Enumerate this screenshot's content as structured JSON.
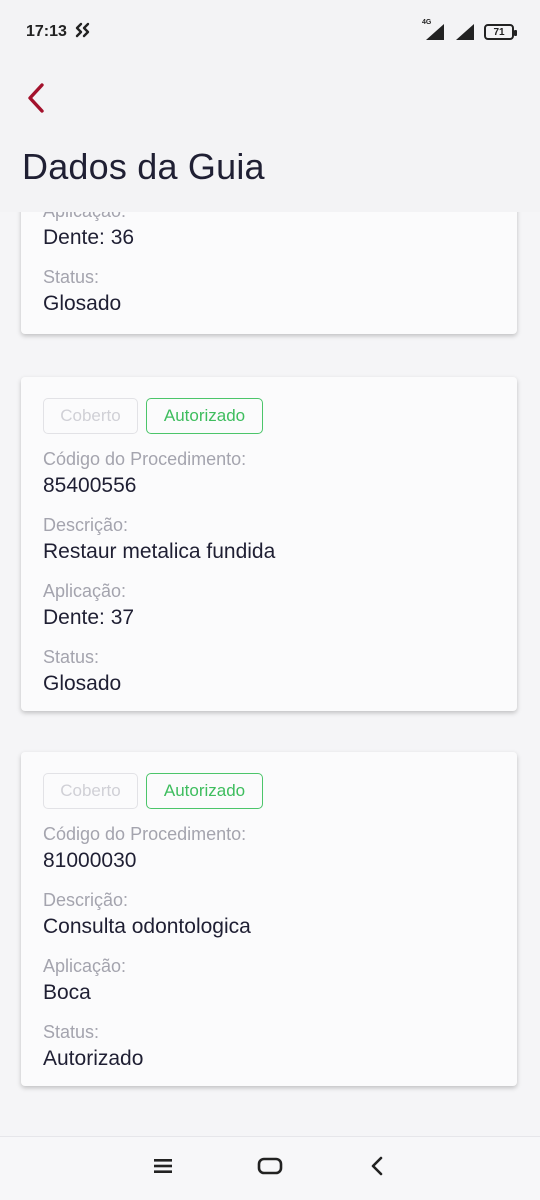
{
  "status_bar": {
    "time": "17:13",
    "network": "4G",
    "battery": "71",
    "icons": [
      "speed-icon",
      "signal-icon",
      "signal-icon",
      "battery-icon"
    ]
  },
  "header": {
    "title": "Dados da Guia",
    "back_icon": "chevron-left-icon",
    "accent_color": "#a3112c"
  },
  "cards": [
    {
      "fields": [
        {
          "label": "Aplicação:",
          "value": "Dente: 36"
        },
        {
          "label": "Status:",
          "value": "Glosado"
        }
      ]
    },
    {
      "badges": [
        "Coberto",
        "Autorizado"
      ],
      "fields": [
        {
          "label": "Código do Procedimento:",
          "value": "85400556"
        },
        {
          "label": "Descrição:",
          "value": "Restaur metalica fundida"
        },
        {
          "label": "Aplicação:",
          "value": "Dente: 37"
        },
        {
          "label": "Status:",
          "value": "Glosado"
        }
      ]
    },
    {
      "badges": [
        "Coberto",
        "Autorizado"
      ],
      "fields": [
        {
          "label": "Código do Procedimento:",
          "value": "81000030"
        },
        {
          "label": "Descrição:",
          "value": "Consulta odontologica"
        },
        {
          "label": "Aplicação:",
          "value": "Boca"
        },
        {
          "label": "Status:",
          "value": "Autorizado"
        }
      ]
    }
  ],
  "colors": {
    "authorized": "#3ebd5e",
    "muted_badge": "#d0d0d6"
  },
  "nav_bar": {
    "icons": [
      "menu-icon",
      "home-icon",
      "back-icon"
    ]
  }
}
